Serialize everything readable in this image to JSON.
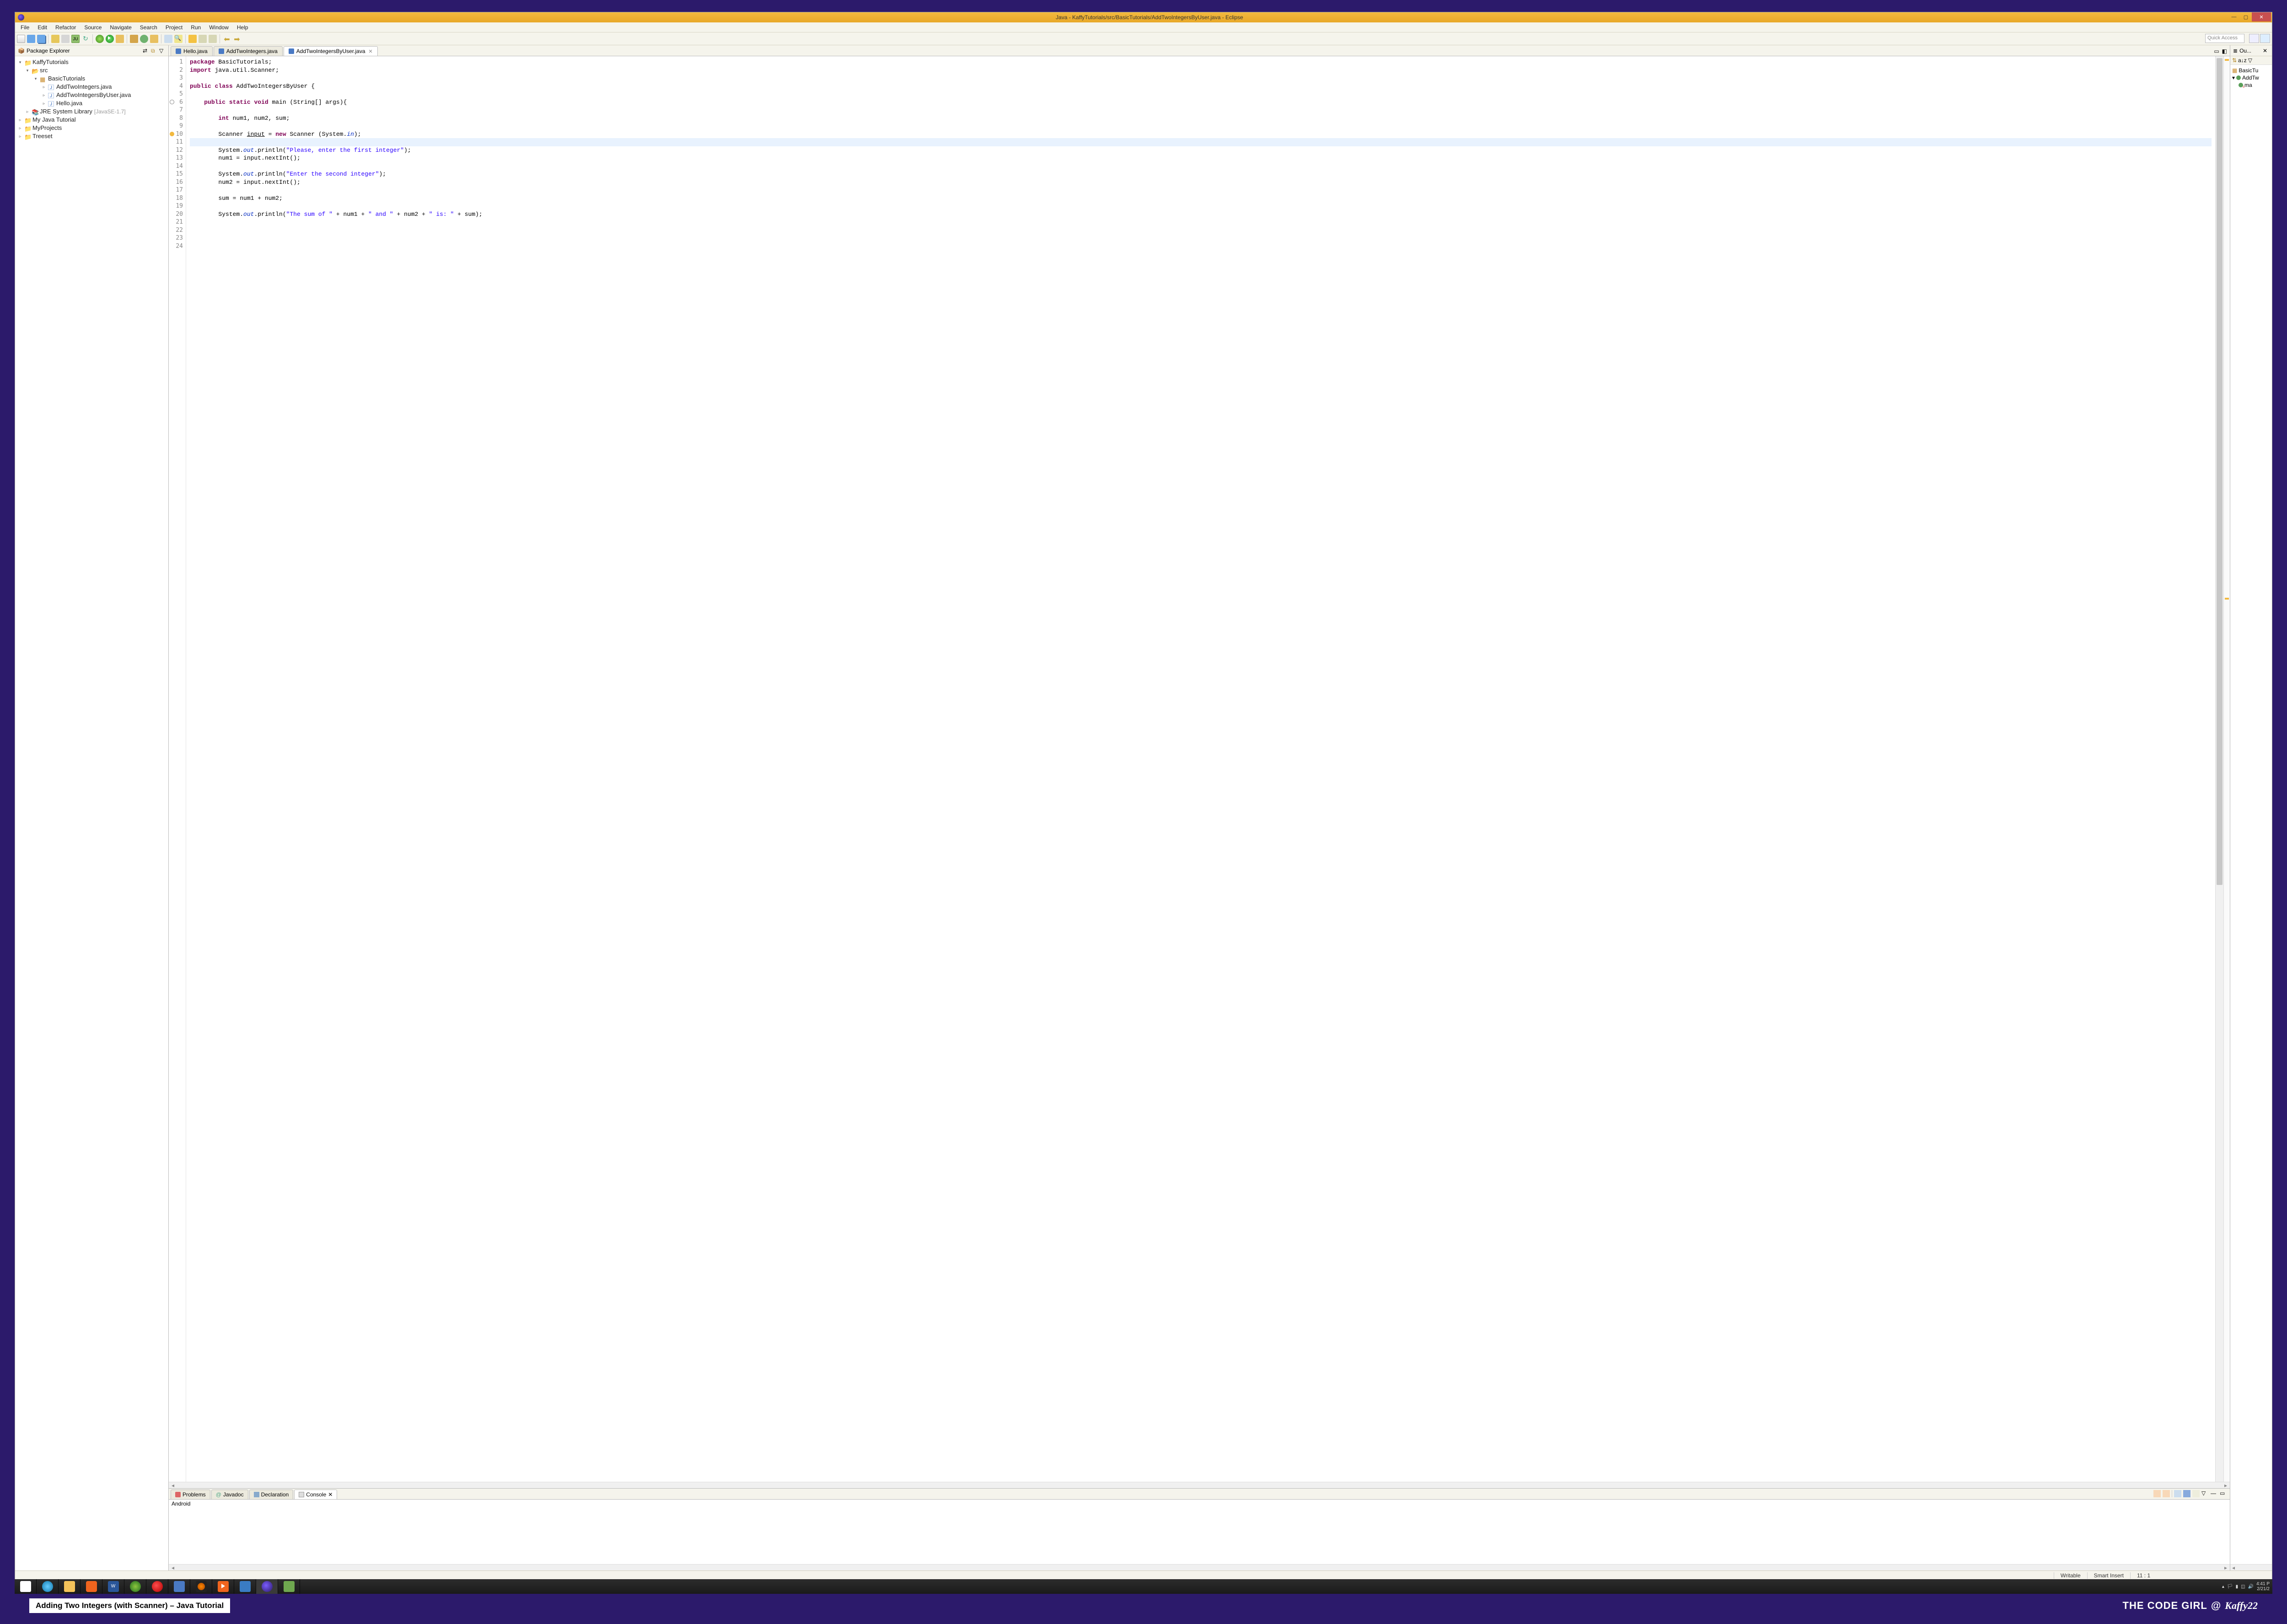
{
  "window": {
    "title": "Java - KaffyTutorials/src/BasicTutorials/AddTwoIntegersByUser.java - Eclipse"
  },
  "menu": [
    "File",
    "Edit",
    "Refactor",
    "Source",
    "Navigate",
    "Search",
    "Project",
    "Run",
    "Window",
    "Help"
  ],
  "quick_access_placeholder": "Quick Access",
  "package_explorer": {
    "title": "Package Explorer",
    "projects": [
      {
        "name": "KaffyTutorials",
        "open": true,
        "children": [
          {
            "name": "src",
            "open": true,
            "type": "folder",
            "children": [
              {
                "name": "BasicTutorials",
                "open": true,
                "type": "package",
                "children": [
                  {
                    "name": "AddTwoIntegers.java",
                    "type": "java"
                  },
                  {
                    "name": "AddTwoIntegersByUser.java",
                    "type": "java"
                  },
                  {
                    "name": "Hello.java",
                    "type": "java"
                  }
                ]
              }
            ]
          },
          {
            "name": "JRE System Library",
            "suffix": "[JavaSE-1.7]",
            "type": "lib"
          }
        ]
      },
      {
        "name": "My Java Tutorial"
      },
      {
        "name": "MyProjects"
      },
      {
        "name": "Treeset"
      }
    ]
  },
  "editor_tabs": [
    {
      "label": "Hello.java",
      "active": false
    },
    {
      "label": "AddTwoIntegers.java",
      "active": false
    },
    {
      "label": "AddTwoIntegersByUser.java",
      "active": true
    }
  ],
  "code_lines": [
    {
      "n": 1,
      "html": "<span class='kw'>package</span> BasicTutorials;"
    },
    {
      "n": 2,
      "html": "<span class='kw'>import</span> java.util.Scanner;"
    },
    {
      "n": 3,
      "html": ""
    },
    {
      "n": 4,
      "html": "<span class='kw'>public</span> <span class='kw'>class</span> AddTwoIntegersByUser {"
    },
    {
      "n": 5,
      "html": ""
    },
    {
      "n": 6,
      "html": "    <span class='kw'>public</span> <span class='kw'>static</span> <span class='kw'>void</span> main (String[] args){"
    },
    {
      "n": 7,
      "html": ""
    },
    {
      "n": 8,
      "html": "        <span class='kw'>int</span> num1, num2, sum;"
    },
    {
      "n": 9,
      "html": ""
    },
    {
      "n": 10,
      "html": "        Scanner <u>input</u> = <span class='kw'>new</span> Scanner (System.<span class='fld'>in</span>);"
    },
    {
      "n": 11,
      "html": "        "
    },
    {
      "n": 12,
      "html": "        System.<span class='fld'>out</span>.println(<span class='str'>\"Please, enter the first integer\"</span>);"
    },
    {
      "n": 13,
      "html": "        num1 = input.nextInt();"
    },
    {
      "n": 14,
      "html": ""
    },
    {
      "n": 15,
      "html": "        System.<span class='fld'>out</span>.println(<span class='str'>\"Enter the second integer\"</span>);"
    },
    {
      "n": 16,
      "html": "        num2 = input.nextInt();"
    },
    {
      "n": 17,
      "html": ""
    },
    {
      "n": 18,
      "html": "        sum = num1 + num2;"
    },
    {
      "n": 19,
      "html": ""
    },
    {
      "n": 20,
      "html": "        System.<span class='fld'>out</span>.println(<span class='str'>\"The sum of \"</span> + num1 + <span class='str'>\" and \"</span> + num2 + <span class='str'>\" is: \"</span> + sum);"
    },
    {
      "n": 21,
      "html": ""
    },
    {
      "n": 22,
      "html": ""
    },
    {
      "n": 23,
      "html": ""
    },
    {
      "n": 24,
      "html": ""
    }
  ],
  "bottom_tabs": [
    {
      "label": "Problems"
    },
    {
      "label": "Javadoc"
    },
    {
      "label": "Declaration"
    },
    {
      "label": "Console",
      "active": true
    }
  ],
  "console_text": "Android",
  "outline": {
    "title": "Ou...",
    "items": [
      "BasicTu",
      "AddTw",
      "ma"
    ]
  },
  "status": {
    "writable": "Writable",
    "insert": "Smart Insert",
    "pos": "11 : 1"
  },
  "systray": {
    "time": "4:41 P",
    "date": "2/21/2"
  },
  "caption": "Adding Two Integers (with Scanner)  – Java Tutorial",
  "brand": {
    "text": "THE  CODE  GIRL",
    "handle": "Kaffy22"
  }
}
